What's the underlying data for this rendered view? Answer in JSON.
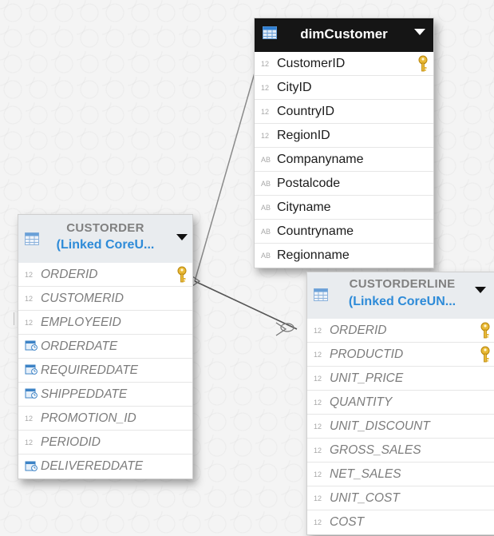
{
  "tables": {
    "dimCustomer": {
      "name": "dimCustomer",
      "columns": [
        {
          "type": "12",
          "name": "CustomerID",
          "key": true
        },
        {
          "type": "12",
          "name": "CityID",
          "key": false
        },
        {
          "type": "12",
          "name": "CountryID",
          "key": false
        },
        {
          "type": "12",
          "name": "RegionID",
          "key": false
        },
        {
          "type": "AB",
          "name": "Companyname",
          "key": false
        },
        {
          "type": "AB",
          "name": "Postalcode",
          "key": false
        },
        {
          "type": "AB",
          "name": "Cityname",
          "key": false
        },
        {
          "type": "AB",
          "name": "Countryname",
          "key": false
        },
        {
          "type": "AB",
          "name": "Regionname",
          "key": false
        }
      ]
    },
    "custorder": {
      "name": "CUSTORDER",
      "subtitle": "(Linked CoreU...",
      "columns": [
        {
          "type": "12",
          "name": "ORDERID",
          "key": true
        },
        {
          "type": "12",
          "name": "CUSTOMERID",
          "key": false
        },
        {
          "type": "12",
          "name": "EMPLOYEEID",
          "key": false
        },
        {
          "type": "date",
          "name": "ORDERDATE",
          "key": false
        },
        {
          "type": "date",
          "name": "REQUIREDDATE",
          "key": false
        },
        {
          "type": "date",
          "name": "SHIPPEDDATE",
          "key": false
        },
        {
          "type": "12",
          "name": "PROMOTION_ID",
          "key": false
        },
        {
          "type": "12",
          "name": "PERIODID",
          "key": false
        },
        {
          "type": "date",
          "name": "DELIVEREDDATE",
          "key": false
        }
      ]
    },
    "custorderline": {
      "name": "CUSTORDERLINE",
      "subtitle": "(Linked CoreUN...",
      "columns": [
        {
          "type": "12",
          "name": "ORDERID",
          "key": true
        },
        {
          "type": "12",
          "name": "PRODUCTID",
          "key": true
        },
        {
          "type": "12",
          "name": "UNIT_PRICE",
          "key": false
        },
        {
          "type": "12",
          "name": "QUANTITY",
          "key": false
        },
        {
          "type": "12",
          "name": "UNIT_DISCOUNT",
          "key": false
        },
        {
          "type": "12",
          "name": "GROSS_SALES",
          "key": false
        },
        {
          "type": "12",
          "name": "NET_SALES",
          "key": false
        },
        {
          "type": "12",
          "name": "UNIT_COST",
          "key": false
        },
        {
          "type": "12",
          "name": "COST",
          "key": false
        }
      ]
    }
  },
  "icons": {
    "table": "table-grid-icon",
    "key": "primary-key-icon",
    "caret": "chevron-down-icon",
    "date": "calendar-icon"
  },
  "colors": {
    "linked_text": "#2e8bd8",
    "dark_header": "#151515",
    "key_gold": "#e8b937"
  }
}
